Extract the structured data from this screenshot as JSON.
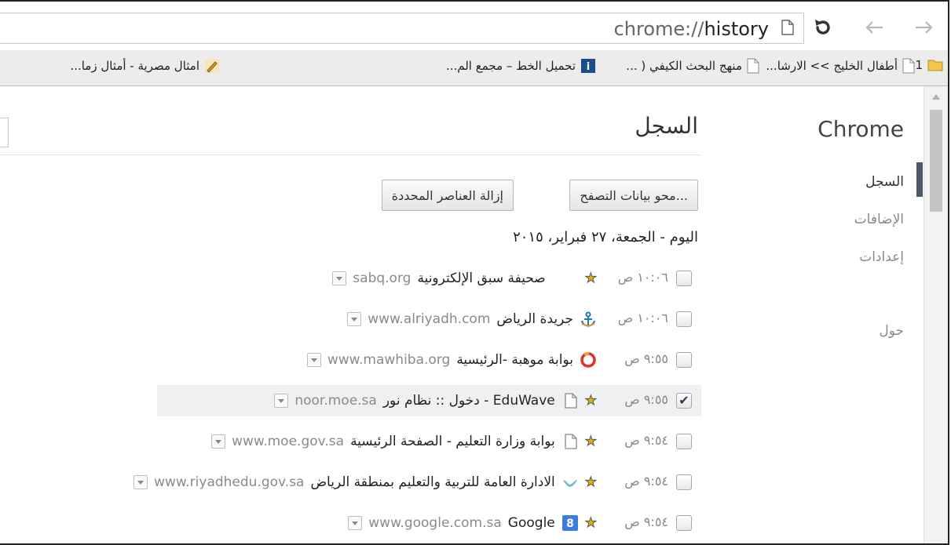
{
  "toolbar": {
    "url_prefix": "chrome://",
    "url_host": "history",
    "reload_icon": "reload-icon",
    "back_icon": "back-arrow-icon",
    "forward_icon": "forward-arrow-icon"
  },
  "bookmarks": [
    {
      "label": "1",
      "icon": "folder-icon"
    },
    {
      "label": "أطفال الخليج >> الارشا...",
      "icon": "page-icon"
    },
    {
      "label": "منهج البحث الكيفي ( ...",
      "icon": "page-icon"
    },
    {
      "label": "تحميل الخط – مجمع الم...",
      "icon": "info-icon"
    },
    {
      "label": "امثال مصرية - أمثال زما...",
      "icon": "pen-icon"
    }
  ],
  "sidebar": {
    "title": "Chrome",
    "items": [
      {
        "label": "السجل",
        "selected": true
      },
      {
        "label": "الإضافات",
        "selected": false
      },
      {
        "label": "إعدادات",
        "selected": false
      },
      {
        "label": "حول",
        "selected": false
      }
    ]
  },
  "main": {
    "title": "السجل",
    "clear_button": "محو بيانات التصفح...",
    "remove_button": "إزالة العناصر المحددة",
    "day_heading": "اليوم - الجمعة، ٢٧ فبراير، ٢٠١٥"
  },
  "entries": [
    {
      "time": "١٠:٠٦ ص",
      "starred": true,
      "icon": "none",
      "title": "صحيفة سبق الإلكترونية",
      "domain": "sabq.org",
      "checked": false
    },
    {
      "time": "١٠:٠٦ ص",
      "starred": false,
      "icon": "anchor-icon",
      "title": "جريدة الرياض",
      "domain": "www.alriyadh.com",
      "checked": false
    },
    {
      "time": "٩:٥٥ ص",
      "starred": false,
      "icon": "circle-logo-icon",
      "title": "بوابة موهبة -الرئيسية",
      "domain": "www.mawhiba.org",
      "checked": false
    },
    {
      "time": "٩:٥٥ ص",
      "starred": true,
      "icon": "page-icon",
      "title": "EduWave - دخول :: نظام نور",
      "domain": "noor.moe.sa",
      "checked": true
    },
    {
      "time": "٩:٥٤ ص",
      "starred": true,
      "icon": "page-icon",
      "title": "بوابة وزارة التعليم - الصفحة الرئيسية",
      "domain": "www.moe.gov.sa",
      "checked": false
    },
    {
      "time": "٩:٥٤ ص",
      "starred": true,
      "icon": "bird-icon",
      "title": "الادارة العامة للتربية والتعليم بمنطقة الرياض",
      "domain": "www.riyadhedu.gov.sa",
      "checked": false
    },
    {
      "time": "٩:٥٤ ص",
      "starred": true,
      "icon": "google-plus-icon",
      "title": "Google",
      "domain": "www.google.com.sa",
      "checked": false
    }
  ]
}
